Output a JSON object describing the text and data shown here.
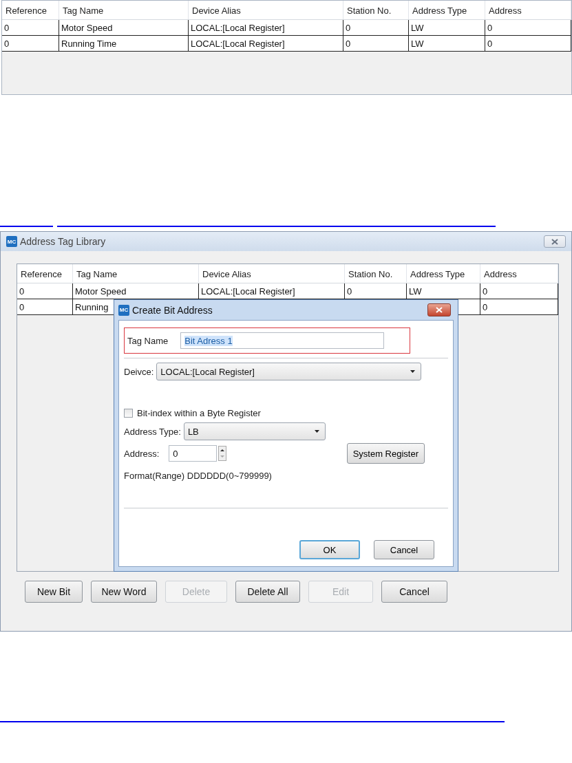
{
  "top_table": {
    "columns": [
      "Reference",
      "Tag Name",
      "Device Alias",
      "Station No.",
      "Address Type",
      "Address"
    ],
    "rows": [
      [
        "0",
        "Motor Speed",
        "LOCAL:[Local Register]",
        "0",
        "LW",
        "0"
      ],
      [
        "0",
        "Running Time",
        "LOCAL:[Local Register]",
        "0",
        "LW",
        "0"
      ]
    ]
  },
  "window": {
    "icon_text": "MC",
    "title": "Address Tag Library",
    "table": {
      "columns": [
        "Reference",
        "Tag Name",
        "Device Alias",
        "Station No.",
        "Address Type",
        "Address"
      ],
      "rows": [
        [
          "0",
          "Motor Speed",
          "LOCAL:[Local Register]",
          "0",
          "LW",
          "0"
        ],
        [
          "0",
          "Running",
          null,
          null,
          null,
          "0"
        ]
      ]
    },
    "buttons": [
      {
        "label": "New Bit",
        "disabled": false
      },
      {
        "label": "New Word",
        "disabled": false
      },
      {
        "label": "Delete",
        "disabled": true
      },
      {
        "label": "Delete All",
        "disabled": false
      },
      {
        "label": "Edit",
        "disabled": true
      },
      {
        "label": "Cancel",
        "disabled": false
      }
    ]
  },
  "dialog": {
    "icon_text": "MC",
    "title": "Create Bit Address",
    "tag_name": {
      "label": "Tag Name",
      "value": "Bit Adress 1",
      "text_selected": true
    },
    "device": {
      "label": "Deivce:",
      "value": "LOCAL:[Local Register]"
    },
    "bit_index": {
      "label": "Bit-index within a Byte Register",
      "checked": false
    },
    "address_type": {
      "label": "Address Type:",
      "value": "LB"
    },
    "address": {
      "label": "Address:",
      "value": "0"
    },
    "system_register": "System Register",
    "format": "Format(Range) DDDDDD(0~799999)",
    "buttons": [
      {
        "label": "OK",
        "focused": true
      },
      {
        "label": "Cancel",
        "focused": false
      }
    ]
  }
}
